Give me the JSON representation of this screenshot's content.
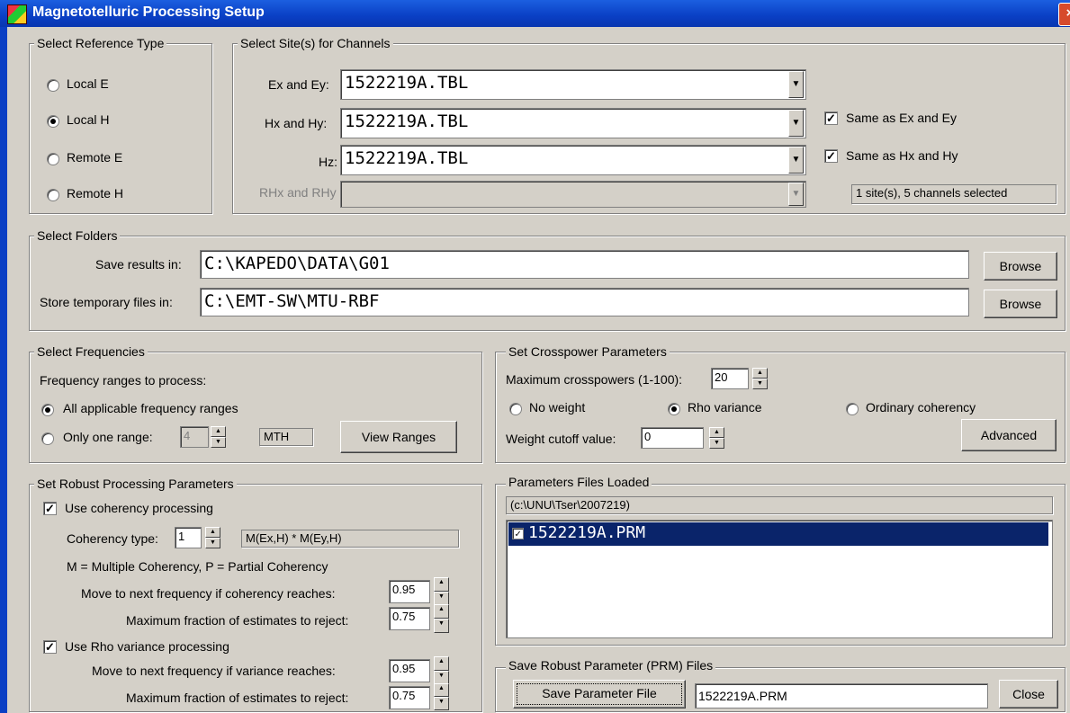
{
  "window": {
    "title": "Magnetotelluric Processing Setup",
    "close_icon": "close-icon",
    "app_icon": "app-icon"
  },
  "reference": {
    "legend": "Select Reference Type",
    "options": [
      {
        "label": "Local E",
        "selected": false
      },
      {
        "label": "Local H",
        "selected": true
      },
      {
        "label": "Remote E",
        "selected": false
      },
      {
        "label": "Remote H",
        "selected": false
      }
    ]
  },
  "sites": {
    "legend": "Select Site(s) for Channels",
    "ex_label": "Ex and Ey:",
    "ex_value": "1522219A.TBL",
    "hx_label": "Hx and Hy:",
    "hx_value": "1522219A.TBL",
    "hz_label": "Hz:",
    "hz_value": "1522219A.TBL",
    "rh_label": "RHx and RHy",
    "rh_value": "",
    "same_ex_label": "Same as Ex and Ey",
    "same_ex_checked": true,
    "same_hx_label": "Same as Hx and Hy",
    "same_hx_checked": true,
    "status": "1 site(s), 5 channels selected"
  },
  "folders": {
    "legend": "Select Folders",
    "save_label": "Save results in:",
    "save_value": "C:\\KAPEDO\\DATA\\G01",
    "temp_label": "Store temporary files in:",
    "temp_value": "C:\\EMT-SW\\MTU-RBF",
    "browse_label": "Browse"
  },
  "frequencies": {
    "legend": "Select Frequencies",
    "ranges_label": "Frequency ranges to process:",
    "all_label": "All applicable frequency ranges",
    "all_selected": true,
    "one_label": "Only one range:",
    "one_value": "4",
    "one_code": "MTH",
    "view_ranges_label": "View Ranges"
  },
  "crosspower": {
    "legend": "Set Crosspower Parameters",
    "max_label": "Maximum crosspowers (1-100):",
    "max_value": "20",
    "weights": [
      {
        "label": "No weight",
        "selected": false
      },
      {
        "label": "Rho variance",
        "selected": true
      },
      {
        "label": "Ordinary coherency",
        "selected": false
      }
    ],
    "cutoff_label": "Weight cutoff value:",
    "cutoff_value": "0",
    "advanced_label": "Advanced"
  },
  "robust": {
    "legend": "Set Robust Processing Parameters",
    "coh_label": "Use coherency processing",
    "coh_checked": true,
    "coh_type_label": "Coherency type:",
    "coh_type_value": "1",
    "coh_type_desc": "M(Ex,H) * M(Ey,H)",
    "coh_note": "M = Multiple Coherency, P = Partial Coherency",
    "coh_next_label": "Move to next frequency if coherency reaches:",
    "coh_next_value": "0.95",
    "coh_reject_label": "Maximum fraction of estimates to reject:",
    "coh_reject_value": "0.75",
    "rho_label": "Use Rho variance processing",
    "rho_checked": true,
    "rho_next_label": "Move to next frequency if variance reaches:",
    "rho_next_value": "0.95",
    "rho_reject_label": "Maximum fraction of estimates to reject:",
    "rho_reject_value": "0.75"
  },
  "param_files": {
    "legend": "Parameters Files Loaded",
    "path": "(c:\\UNU\\Tser\\2007219)",
    "items": [
      {
        "label": "1522219A.PRM",
        "checked": true
      }
    ]
  },
  "save_prm": {
    "legend": "Save Robust Parameter (PRM) Files",
    "save_button_label": "Save Parameter File",
    "file_value": "1522219A.PRM",
    "close_label": "Close"
  }
}
